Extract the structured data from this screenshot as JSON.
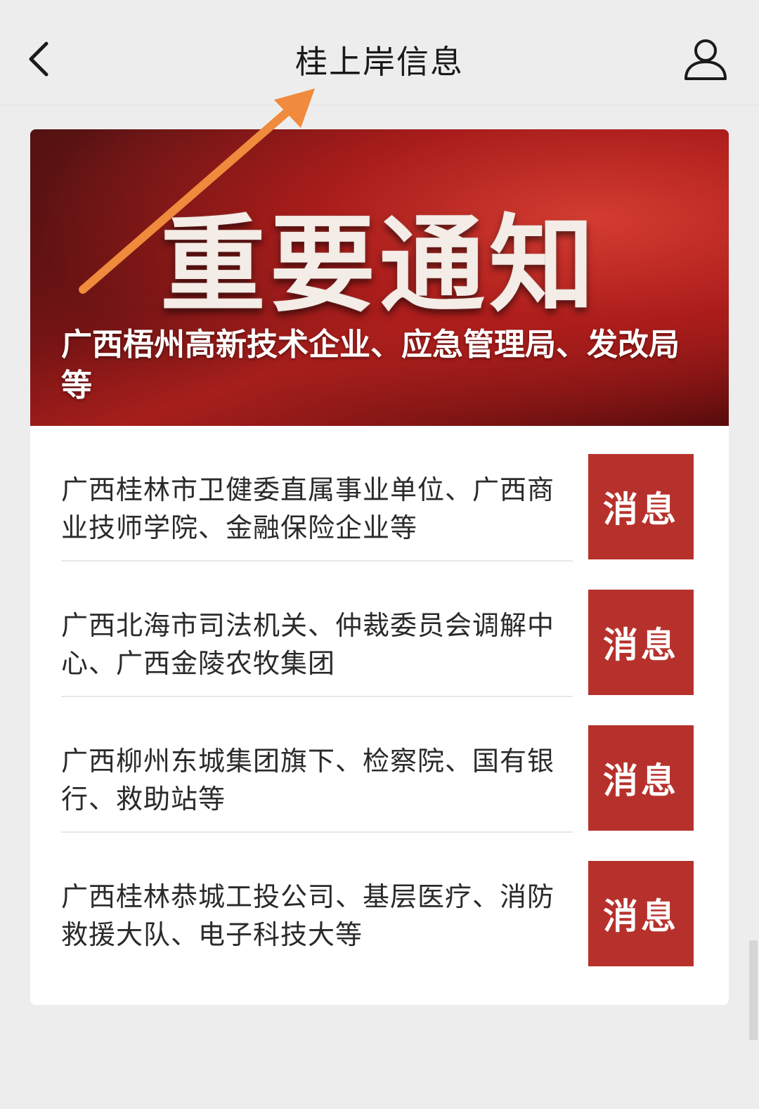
{
  "nav": {
    "title": "桂上岸信息",
    "back_icon": "chevron-left-icon",
    "user_icon": "user-icon"
  },
  "banner": {
    "headline": "重要通知",
    "subtitle": "广西梧州高新技术企业、应急管理局、发改局等"
  },
  "items": [
    {
      "text": "广西桂林市卫健委直属事业单位、广西商业技师学院、金融保险企业等",
      "tag": "消息"
    },
    {
      "text": "广西北海市司法机关、仲裁委员会调解中心、广西金陵农牧集团",
      "tag": "消息"
    },
    {
      "text": "广西柳州东城集团旗下、检察院、国有银行、救助站等",
      "tag": "消息"
    },
    {
      "text": "广西桂林恭城工投公司、基层医疗、消防救援大队、电子科技大等",
      "tag": "消息"
    }
  ],
  "colors": {
    "accent_red": "#b7312c",
    "annotation_arrow": "#f08a3c",
    "background": "#ededed"
  }
}
